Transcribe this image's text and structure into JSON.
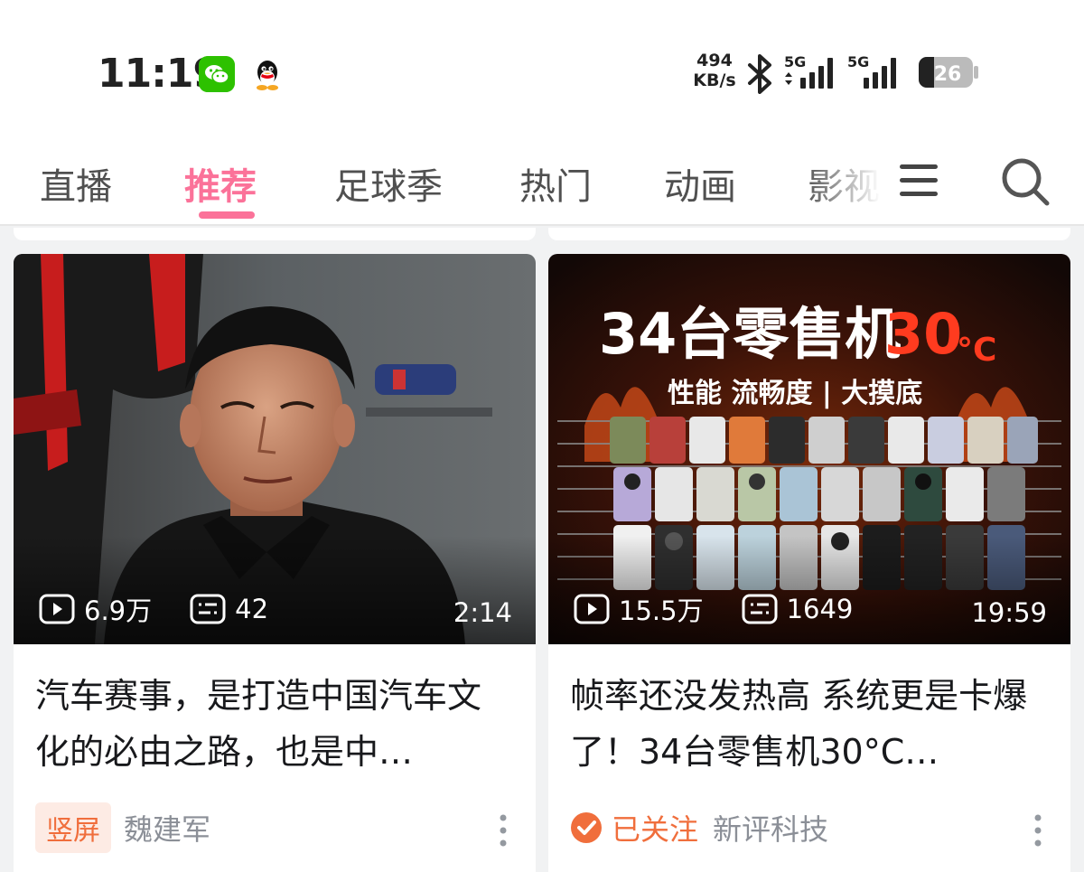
{
  "status_bar": {
    "time": "11:19",
    "net_speed_value": "494",
    "net_speed_unit": "KB/s",
    "signal1_label": "5G",
    "signal2_label": "5G",
    "battery_level": "26",
    "icons": [
      "wechat-icon",
      "qq-icon",
      "bluetooth-icon",
      "signal-icon",
      "battery-icon"
    ]
  },
  "tabs": [
    {
      "label": "直播",
      "active": false
    },
    {
      "label": "推荐",
      "active": true
    },
    {
      "label": "足球季",
      "active": false
    },
    {
      "label": "热门",
      "active": false
    },
    {
      "label": "动画",
      "active": false
    },
    {
      "label": "影视",
      "active": false
    }
  ],
  "colors": {
    "accent": "#fb7299",
    "tag_orange": "#f06e3c",
    "meta_gray": "#8b8f97",
    "background": "#f1f2f3"
  },
  "feed": [
    {
      "views": "6.9万",
      "danmaku": "42",
      "duration": "2:14",
      "title": "汽车赛事，是打造中国汽车文化的必由之路，也是中…",
      "tag": "竖屏",
      "author": "魏建军"
    },
    {
      "views": "15.5万",
      "danmaku": "1649",
      "duration": "19:59",
      "title": "帧率还没发热高 系统更是卡爆了！34台零售机30°C…",
      "poster_title_a": "34台零售机",
      "poster_title_b": "30",
      "poster_title_unit": "°C",
      "poster_subtitle": "性能 流畅度 | 大摸底",
      "follow_status": "已关注",
      "author": "新评科技"
    }
  ]
}
